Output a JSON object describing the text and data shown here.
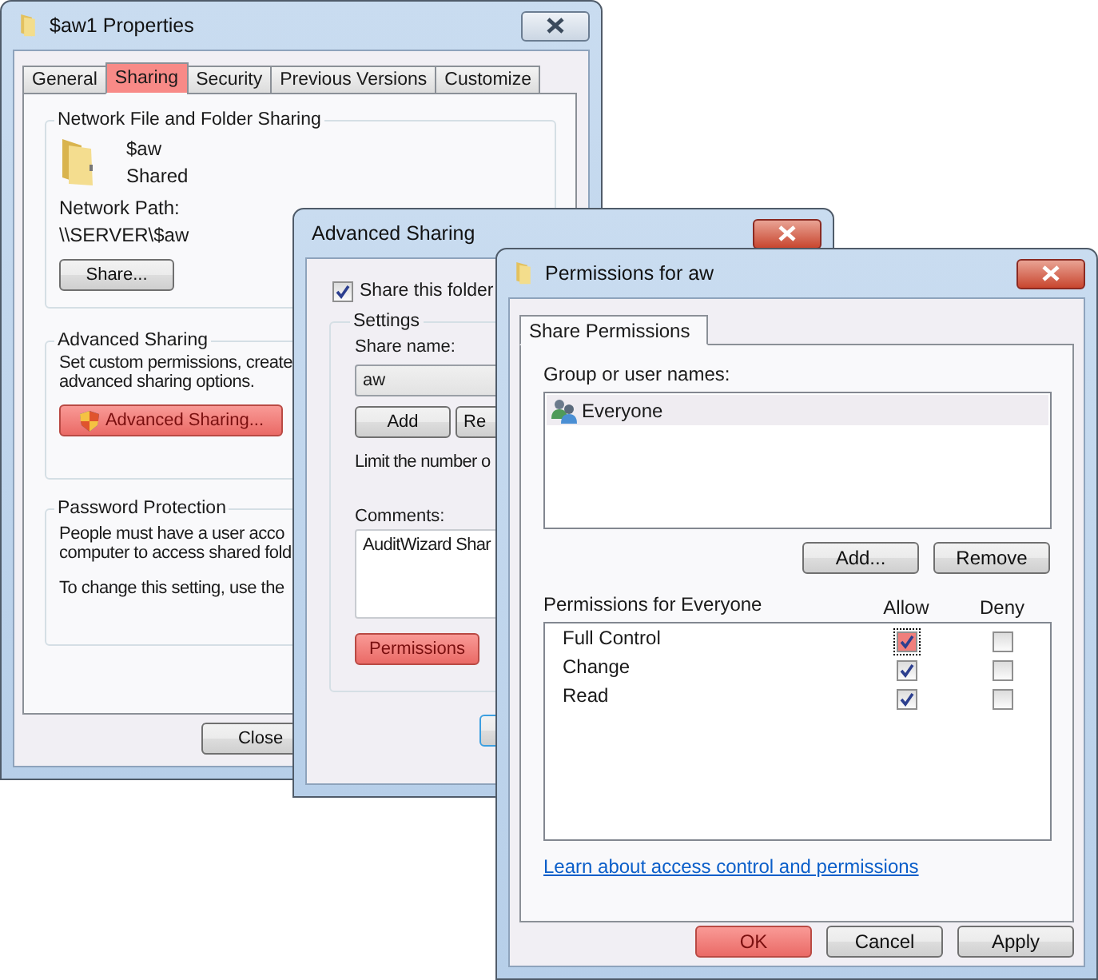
{
  "properties_window": {
    "title": "$aw1 Properties",
    "tabs": [
      {
        "label": "General",
        "selected": false,
        "highlighted": false
      },
      {
        "label": "Sharing",
        "selected": true,
        "highlighted": true
      },
      {
        "label": "Security",
        "selected": false,
        "highlighted": false
      },
      {
        "label": "Previous Versions",
        "selected": false,
        "highlighted": false
      },
      {
        "label": "Customize",
        "selected": false,
        "highlighted": false
      }
    ],
    "network_sharing": {
      "heading": "Network File and Folder Sharing",
      "share_name": "$aw",
      "share_status": "Shared",
      "path_label": "Network Path:",
      "path": "\\\\SERVER\\$aw",
      "share_button": "Share..."
    },
    "advanced_sharing": {
      "heading": "Advanced Sharing",
      "lines": [
        "Set custom permissions, create",
        "advanced sharing options."
      ],
      "button": {
        "label": "Advanced Sharing...",
        "highlighted": true
      }
    },
    "password_protection": {
      "heading": "Password Protection",
      "lines": [
        "People must have a user acco",
        "computer to access shared fold"
      ],
      "note": "To change this setting, use the"
    },
    "close_button": "Close"
  },
  "advanced_sharing_window": {
    "title": "Advanced Sharing",
    "share_checkbox": {
      "label": "Share this folder",
      "checked": true
    },
    "settings": {
      "heading": "Settings",
      "share_name_label": "Share name:",
      "share_name": "aw",
      "buttons": [
        "Add",
        "Re"
      ],
      "limit_text": "Limit the number o",
      "comments_label": "Comments:",
      "comments": "AuditWizard Shar",
      "permissions_button": {
        "label": "Permissions",
        "highlighted": true
      }
    }
  },
  "permissions_window": {
    "title": "Permissions for aw",
    "tabs": [
      {
        "label": "Share Permissions",
        "selected": true
      }
    ],
    "group_label": "Group or user names:",
    "users": [
      {
        "name": "Everyone",
        "selected": true
      }
    ],
    "buttons": [
      "Add...",
      "Remove"
    ],
    "permissions_label": "Permissions for Everyone",
    "columns": [
      "Allow",
      "Deny"
    ],
    "permissions": [
      {
        "name": "Full Control",
        "allow": true,
        "deny": false,
        "highlighted": true
      },
      {
        "name": "Change",
        "allow": true,
        "deny": false,
        "highlighted": false
      },
      {
        "name": "Read",
        "allow": true,
        "deny": false,
        "highlighted": false
      }
    ],
    "link": "Learn about access control and permissions",
    "footer_buttons": [
      {
        "label": "OK",
        "highlighted": true
      },
      {
        "label": "Cancel",
        "highlighted": false
      },
      {
        "label": "Apply",
        "highlighted": false
      }
    ]
  }
}
